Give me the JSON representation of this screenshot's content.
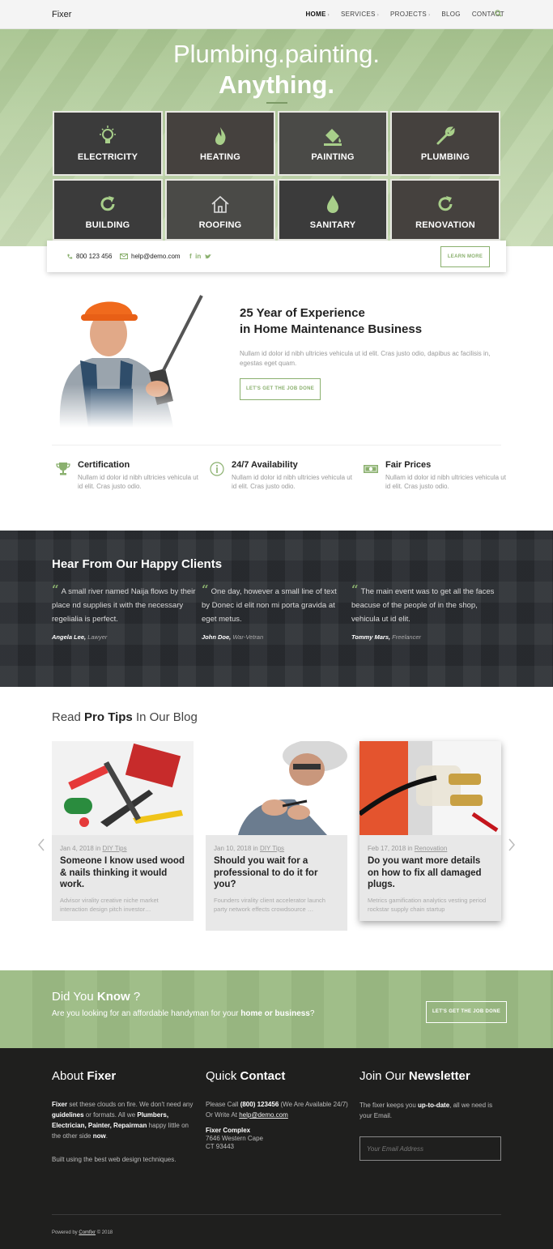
{
  "nav": {
    "logo": "Fixer",
    "items": [
      {
        "label": "HOME",
        "caret": true,
        "active": true
      },
      {
        "label": "SERVICES",
        "caret": true
      },
      {
        "label": "PROJECTS",
        "caret": true
      },
      {
        "label": "BLOG",
        "caret": false
      },
      {
        "label": "CONTACT",
        "caret": false
      }
    ],
    "caret_glyph": "›"
  },
  "hero": {
    "title": "Plumbing.painting.",
    "subtitle": "Anything.",
    "services": [
      {
        "label": "ELECTRICITY",
        "icon": "lightbulb-icon"
      },
      {
        "label": "HEATING",
        "icon": "flame-icon"
      },
      {
        "label": "PAINTING",
        "icon": "paint-bucket-icon"
      },
      {
        "label": "PLUMBING",
        "icon": "wrench-icon"
      },
      {
        "label": "BUILDING",
        "icon": "refresh-icon"
      },
      {
        "label": "ROOFING",
        "icon": "house-icon"
      },
      {
        "label": "SANITARY",
        "icon": "water-drop-icon"
      },
      {
        "label": "RENOVATION",
        "icon": "refresh-icon"
      }
    ]
  },
  "contact_bar": {
    "phone": "800 123 456",
    "email": "help@demo.com",
    "socials": [
      "f",
      "in",
      "twitter"
    ],
    "learn_more": "LEARN MORE"
  },
  "experience": {
    "title_line1": "25 Year of Experience",
    "title_line2": "in Home Maintenance Business",
    "text": "Nullam id dolor id nibh ultricies vehicula ut id elit. Cras justo odio, dapibus ac facilisis in, egestas eget quam.",
    "button": "LET'S GET THE JOB DONE"
  },
  "features": [
    {
      "title": "Certification",
      "text": "Nullam id dolor id nibh ultricies vehicula ut id elit. Cras justo odio.",
      "icon": "trophy-icon"
    },
    {
      "title": "24/7 Availability",
      "text": "Nullam id dolor id nibh ultricies vehicula ut id elit. Cras justo odio.",
      "icon": "info-icon"
    },
    {
      "title": "Fair Prices",
      "text": "Nullam id dolor id nibh ultricies vehicula ut id elit. Cras justo odio.",
      "icon": "money-icon"
    }
  ],
  "testimonials": {
    "heading": "Hear From Our Happy Clients",
    "quote_mark": "“",
    "items": [
      {
        "text": "A small river named Naija flows by their place nd supplies it with the necessary regelialia is perfect.",
        "name": "Angela Lee,",
        "role": "Lawyer"
      },
      {
        "text": "One day, however a small line of text by Donec id elit non mi porta gravida at eget metus.",
        "name": "John Doe,",
        "role": "War-Vetran"
      },
      {
        "text": "The main event was to get all the faces beacuse of the people of in the shop, vehicula ut id elit.",
        "name": "Tommy Mars,",
        "role": "Freelancer"
      }
    ]
  },
  "blog": {
    "heading_pre": "Read",
    "heading_bold": "Pro Tips",
    "heading_post": "In Our Blog",
    "posts": [
      {
        "date": "Jan 4, 2018",
        "in": "in",
        "category": "DIY Tips",
        "title": "Someone I know used wood & nails thinking it would work.",
        "excerpt": "Advisor virality creative niche market interaction design pitch investor…"
      },
      {
        "date": "Jan 10, 2018",
        "in": "in",
        "category": "DIY Tips",
        "title": "Should you wait for a professional to do it for you?",
        "excerpt": "Founders virality client accelerator launch party network effects crowdsource …"
      },
      {
        "date": "Feb 17, 2018",
        "in": "in",
        "category": "Renovation",
        "title": "Do you want more details on how to fix all damaged plugs.",
        "excerpt": "Metrics gamification analytics vesting period rockstar supply chain startup"
      }
    ]
  },
  "know": {
    "heading_pre": "Did You",
    "heading_bold": "Know",
    "heading_post": "?",
    "text_pre": "Are you looking for an affordable handyman for your",
    "text_bold": "home or business",
    "text_post": "?",
    "button": "LET'S GET THE JOB DONE"
  },
  "footer": {
    "about": {
      "h_pre": "About",
      "h_bold": "Fixer",
      "brand": "Fixer",
      "t1": " set these clouds on fire. We don't need any ",
      "guidelines": "guidelines",
      "t2": " or formats. All we ",
      "roles": "Plumbers, Electrician, Painter, Repairman",
      "t3": " happy little on the other side ",
      "now": "now",
      "t4": ".",
      "built": "Built using the best web design techniques."
    },
    "contact": {
      "h_pre": "Quick",
      "h_bold": "Contact",
      "call": "Please Call ",
      "phone": "(800) 123456",
      "t1": " (We Are Available 24/7) Or Write At ",
      "email": "help@demo.com",
      "company": "Fixer Complex",
      "addr1": "7646 Western Cape",
      "addr2": "CT 93443"
    },
    "newsletter": {
      "h_pre": "Join Our",
      "h_bold": "Newsletter",
      "t1": "The fixer keeps you ",
      "bold": "up-to-date",
      "t2": ", all we need is your Email.",
      "placeholder": "Your Email Address"
    },
    "copy_pre": "Powered by ",
    "copy_link": "Comfixr",
    "copy_post": " © 2018"
  },
  "colors": {
    "accent": "#8ab06e",
    "dark": "#1f1f1e",
    "testimonial_bg": "#2b2e33"
  }
}
